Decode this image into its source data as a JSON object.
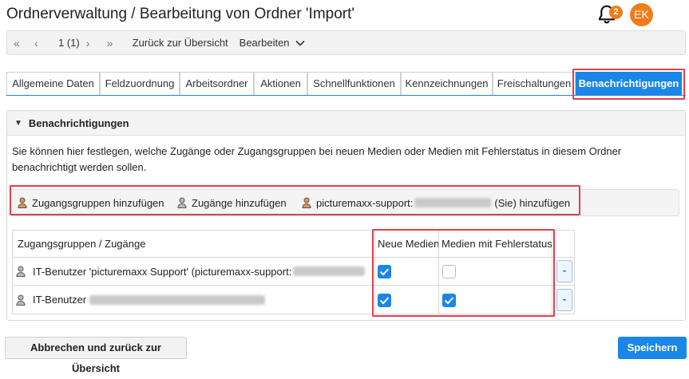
{
  "page": {
    "title": "Ordnerverwaltung / Bearbeitung von Ordner 'Import'",
    "notifications_count": "2",
    "avatar_initials": "EK"
  },
  "toolbar": {
    "page_info": "1 (1)",
    "back_link": "Zurück zur Übersicht",
    "edit_menu": "Bearbeiten"
  },
  "tabs": [
    {
      "label": "Allgemeine Daten",
      "active": false
    },
    {
      "label": "Feldzuordnung",
      "active": false
    },
    {
      "label": "Arbeitsordner",
      "active": false
    },
    {
      "label": "Aktionen",
      "active": false
    },
    {
      "label": "Schnellfunktionen",
      "active": false
    },
    {
      "label": "Kennzeichnungen",
      "active": false
    },
    {
      "label": "Freischaltungen",
      "active": false
    },
    {
      "label": "Benachrichtigungen",
      "active": true
    }
  ],
  "panel": {
    "title": "Benachrichtigungen",
    "description": "Sie können hier festlegen, welche Zugänge oder Zugangsgruppen bei neuen Medien oder Medien mit Fehlerstatus in diesem Ordner benachrichtigt werden sollen.",
    "add_group": "Zugangsgruppen hinzufügen",
    "add_access": "Zugänge hinzufügen",
    "add_self_prefix": "picturemaxx-support:",
    "add_self_suffix": "(Sie) hinzufügen"
  },
  "table": {
    "headers": [
      "Zugangsgruppen / Zugänge",
      "Neue Medien",
      "Medien mit Fehlerstatus"
    ],
    "rows": [
      {
        "name": "IT-Benutzer 'picturemaxx Support' (picturemaxx-support:",
        "new_media": true,
        "error_status": false,
        "remove_label": "-"
      },
      {
        "name": "IT-Benutzer",
        "new_media": true,
        "error_status": true,
        "remove_label": "-"
      }
    ]
  },
  "footer": {
    "cancel_label": "Abbrechen und zurück zur Übersicht",
    "save_label": "Speichern"
  },
  "colors": {
    "accent": "#1a86e8",
    "highlight": "#e0404a",
    "badge": "#f07c1a"
  }
}
